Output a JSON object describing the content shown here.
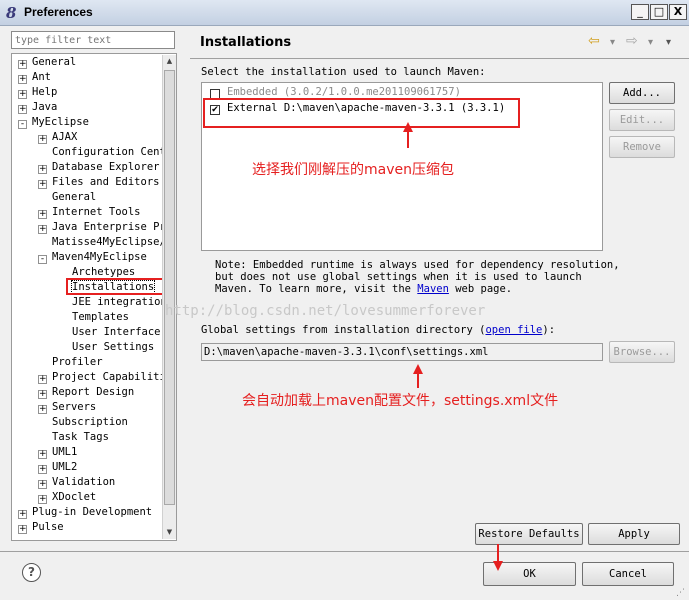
{
  "window": {
    "title": "Preferences",
    "app_icon": "eclipse-icon",
    "controls": {
      "minimize": "_",
      "maximize": "□",
      "close": "X"
    }
  },
  "filter": {
    "placeholder": "type filter text"
  },
  "tree": {
    "items": [
      {
        "label": "General",
        "exp": "+"
      },
      {
        "label": "Ant",
        "exp": "+"
      },
      {
        "label": "Help",
        "exp": "+"
      },
      {
        "label": "Java",
        "exp": "+"
      },
      {
        "label": "MyEclipse",
        "exp": "-"
      },
      {
        "label": "AJAX",
        "exp": "+"
      },
      {
        "label": "Configuration Cent",
        "exp": ""
      },
      {
        "label": "Database Explorer",
        "exp": "+"
      },
      {
        "label": "Files and Editors",
        "exp": "+"
      },
      {
        "label": "General",
        "exp": ""
      },
      {
        "label": "Internet Tools",
        "exp": "+"
      },
      {
        "label": "Java Enterprise Pr",
        "exp": "+"
      },
      {
        "label": "Matisse4MyEclipse/",
        "exp": ""
      },
      {
        "label": "Maven4MyEclipse",
        "exp": "-"
      },
      {
        "label": "Archetypes",
        "exp": ""
      },
      {
        "label": "Installations",
        "exp": ""
      },
      {
        "label": "JEE integration",
        "exp": ""
      },
      {
        "label": "Templates",
        "exp": ""
      },
      {
        "label": "User Interface",
        "exp": ""
      },
      {
        "label": "User Settings",
        "exp": ""
      },
      {
        "label": "Profiler",
        "exp": ""
      },
      {
        "label": "Project Capabiliti",
        "exp": "+"
      },
      {
        "label": "Report Design",
        "exp": "+"
      },
      {
        "label": "Servers",
        "exp": "+"
      },
      {
        "label": "Subscription",
        "exp": ""
      },
      {
        "label": "Task Tags",
        "exp": ""
      },
      {
        "label": "UML1",
        "exp": "+"
      },
      {
        "label": "UML2",
        "exp": "+"
      },
      {
        "label": "Validation",
        "exp": "+"
      },
      {
        "label": "XDoclet",
        "exp": "+"
      },
      {
        "label": "Plug-in Development",
        "exp": "+"
      },
      {
        "label": "Pulse",
        "exp": "+"
      }
    ]
  },
  "panel": {
    "title": "Installations",
    "nav": {
      "back": "⇦",
      "forward": "⇨",
      "menu": "▾"
    },
    "select_label": "Select the installation used to launch Maven:",
    "installations": [
      {
        "text": "Embedded (3.0.2/1.0.0.me201109061757)",
        "checked": false
      },
      {
        "text": "External D:\\maven\\apache-maven-3.3.1 (3.3.1)",
        "checked": true
      }
    ],
    "check_mark": "✔",
    "buttons": {
      "add": "Add...",
      "edit": "Edit...",
      "remove": "Remove"
    },
    "note_lines": [
      "Note: Embedded runtime is always used for dependency resolution,",
      "but does not use global settings when it is used to launch"
    ],
    "note_line3_prefix": "Maven. To learn more, visit the",
    "note_line3_link": "Maven",
    "note_line3_suffix": "web page.",
    "global_label_prefix": "Global settings from installation directory (",
    "global_label_link": "open file",
    "global_label_suffix": "):",
    "settings_path": "D:\\maven\\apache-maven-3.3.1\\conf\\settings.xml",
    "browse": "Browse...",
    "restore_defaults": "Restore Defaults",
    "apply": "Apply"
  },
  "annotations": {
    "maven_archive": "选择我们刚解压的maven压缩包",
    "auto_load": "会自动加载上maven配置文件，settings.xml文件",
    "color": "#e52020"
  },
  "watermark": "http://blog.csdn.net/lovesummerforever",
  "footer": {
    "help": "?",
    "ok": "OK",
    "cancel": "Cancel"
  }
}
